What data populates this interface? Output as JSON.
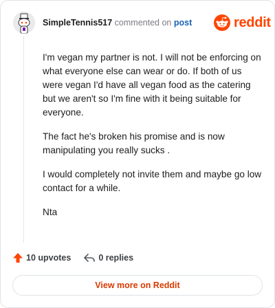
{
  "comment": {
    "username": "SimpleTennis517",
    "action_text": " commented on ",
    "post_link": "post",
    "paragraphs": [
      "I'm vegan my partner is not. I will not be enforcing on what everyone else can wear or do. If both of us were vegan I'd have all vegan food as the catering but we aren't so I'm fine with it being suitable for everyone.",
      "The fact he's broken his promise and is now manipulating you really sucks .",
      "I would completely not invite them and maybe go low contact for a while.",
      "Nta"
    ]
  },
  "brand": {
    "wordmark": "reddit",
    "color": "#ff4500"
  },
  "actions": {
    "upvotes_label": "10 upvotes",
    "replies_label": "0 replies"
  },
  "footer": {
    "view_more_label": "View more on Reddit"
  },
  "colors": {
    "accent": "#ff4500",
    "link": "#1a63b8",
    "cta_text": "#d93900"
  }
}
